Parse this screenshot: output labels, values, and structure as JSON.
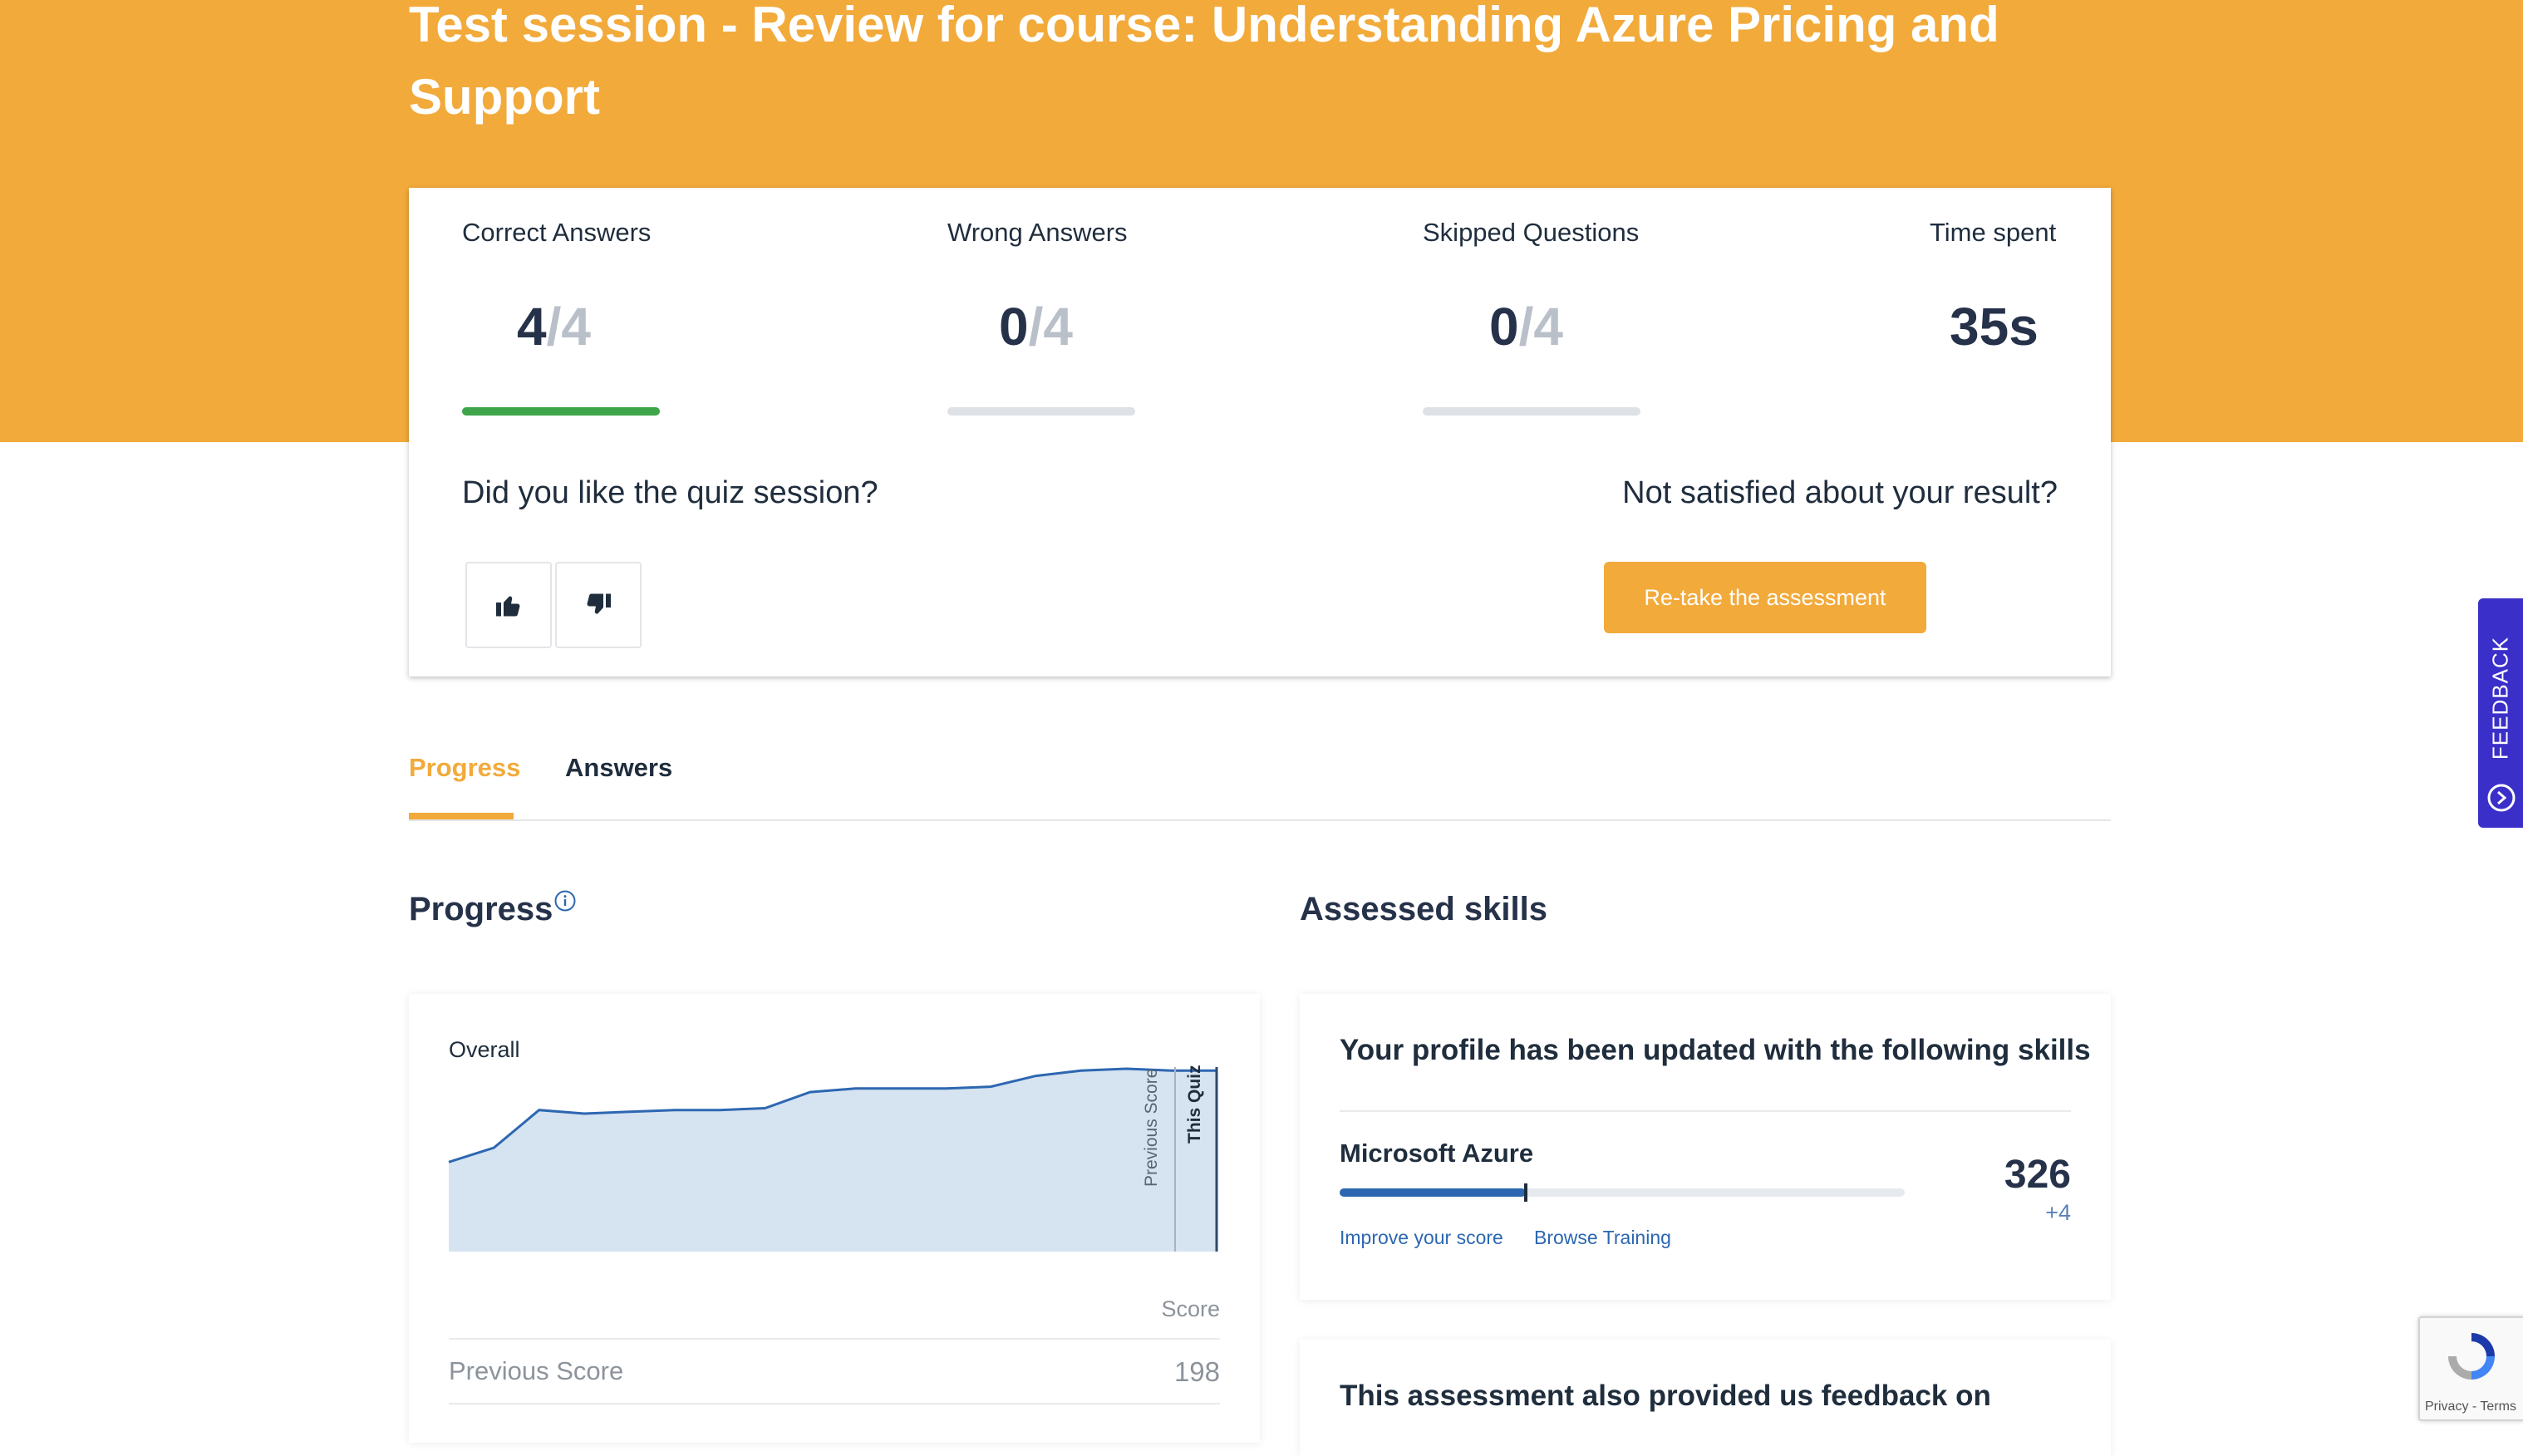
{
  "header": {
    "title": "Test session - Review for course: Understanding Azure Pricing and Support"
  },
  "summary": {
    "correct": {
      "label": "Correct Answers",
      "value": "4",
      "total": "/4",
      "progress": 1.0
    },
    "wrong": {
      "label": "Wrong Answers",
      "value": "0",
      "total": "/4",
      "progress": 0
    },
    "skipped": {
      "label": "Skipped Questions",
      "value": "0",
      "total": "/4",
      "progress": 0
    },
    "time": {
      "label": "Time spent",
      "value": "35s"
    },
    "like_question": "Did you like the quiz session?",
    "thumbs_up_icon": "thumbs-up-icon",
    "thumbs_down_icon": "thumbs-down-icon",
    "not_satisfied": "Not satisfied about your result?",
    "retake_label": "Re-take the assessment"
  },
  "tabs": [
    {
      "label": "Progress",
      "active": true
    },
    {
      "label": "Answers",
      "active": false
    }
  ],
  "progress_section": {
    "title": "Progress",
    "info_icon": "info-icon",
    "overall_label": "Overall",
    "previous_score_marker": "Previous Score",
    "this_quiz_marker": "This Quiz",
    "score_header": "Score",
    "previous_score_label": "Previous Score",
    "previous_score_value": "198"
  },
  "chart_data": {
    "type": "area",
    "title": "Overall",
    "xlabel": "",
    "ylabel": "",
    "values": [
      0.48,
      0.56,
      0.77,
      0.75,
      0.76,
      0.77,
      0.77,
      0.78,
      0.87,
      0.89,
      0.89,
      0.89,
      0.9,
      0.96,
      0.99,
      1.0,
      0.99,
      0.99
    ],
    "markers": [
      "Previous Score",
      "This Quiz"
    ],
    "grid": false,
    "fill_color": "#d6e3f1",
    "line_color": "#2d67b1"
  },
  "skills_section": {
    "title": "Assessed skills",
    "panel_title": "Your profile has been updated with the following skills",
    "skills": [
      {
        "name": "Microsoft Azure",
        "score": "326",
        "delta": "+4",
        "progress": 0.33,
        "improve_label": "Improve your score",
        "browse_label": "Browse Training"
      }
    ],
    "feedback_title": "This assessment also provided us feedback on"
  },
  "feedback_tab": {
    "label": "FEEDBACK",
    "icon": "feedback-icon"
  },
  "recaptcha": {
    "label": "Privacy - Terms",
    "icon": "recaptcha-icon"
  },
  "colors": {
    "brand_orange": "#f2aa3b",
    "success_green": "#3fa54a",
    "link_blue": "#2d67b1",
    "feedback_purple": "#3b2fc9"
  }
}
